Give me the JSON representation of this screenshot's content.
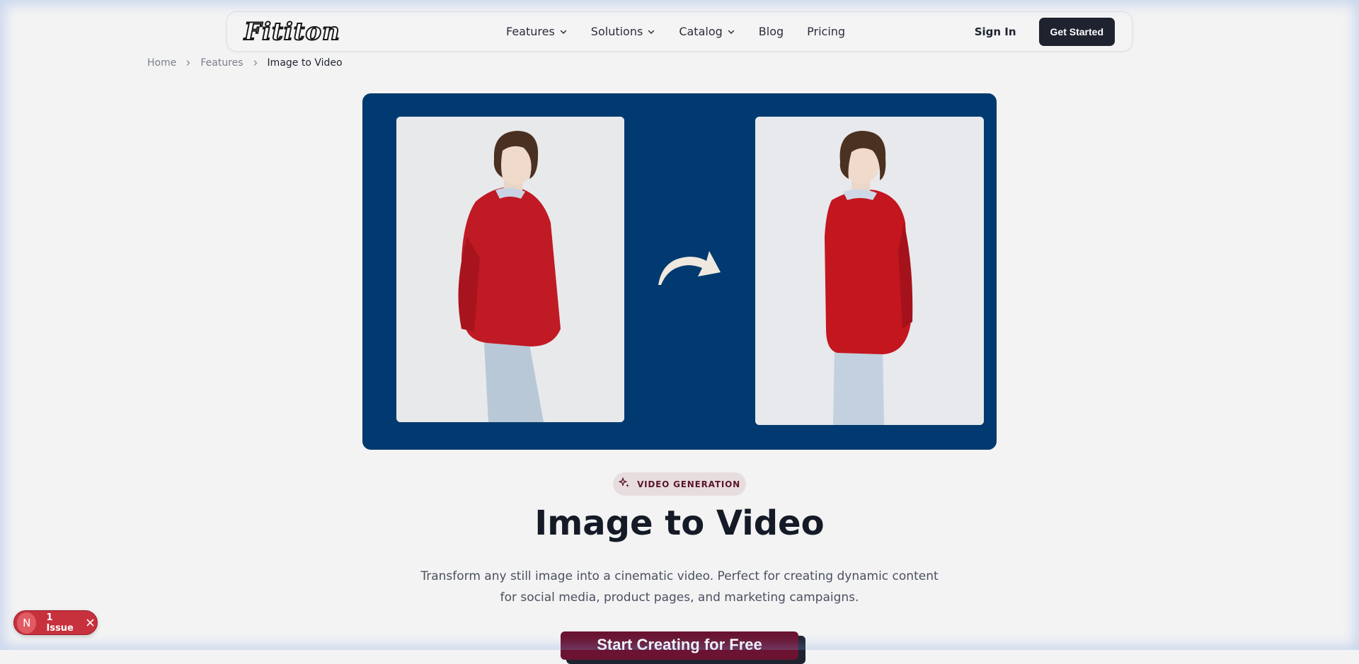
{
  "nav": {
    "logo": "Fititon",
    "items": [
      {
        "label": "Features",
        "has_dropdown": true
      },
      {
        "label": "Solutions",
        "has_dropdown": true
      },
      {
        "label": "Catalog",
        "has_dropdown": true
      },
      {
        "label": "Blog",
        "has_dropdown": false
      },
      {
        "label": "Pricing",
        "has_dropdown": false
      }
    ],
    "sign_in": "Sign In",
    "get_started": "Get Started"
  },
  "breadcrumb": [
    "Home",
    "Features",
    "Image to Video"
  ],
  "hero": {
    "background_color": "#003a70",
    "left_image": "woman-red-sweater-side-view",
    "right_image": "woman-red-sweater-turned-view",
    "arrow_icon": "curved-arrow-icon"
  },
  "badge": {
    "icon": "sparkle-icon",
    "label": "VIDEO GENERATION"
  },
  "headline": "Image to Video",
  "subtitle": "Transform any still image into a cinematic video. Perfect for creating dynamic content for social media, product pages, and marketing campaigns.",
  "cta": "Start Creating for Free",
  "issue_pill": {
    "logo": "N",
    "label": "1 Issue"
  },
  "colors": {
    "accent": "#6b1330",
    "dark": "#1f2330",
    "hero": "#003a70",
    "issue": "#c7313d"
  }
}
